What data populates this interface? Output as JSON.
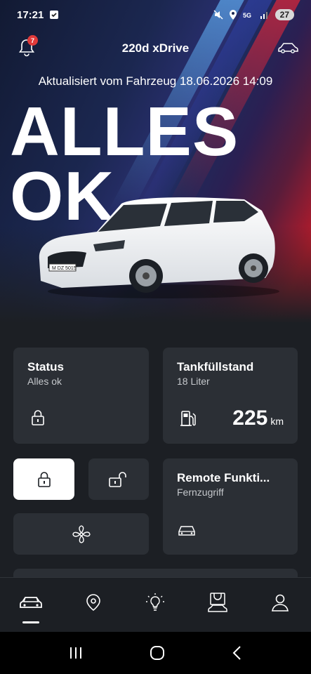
{
  "status_bar": {
    "time": "17:21",
    "battery": "27"
  },
  "header": {
    "title": "220d xDrive",
    "notification_count": "7"
  },
  "updated_text": "Aktualisiert vom Fahrzeug 18.06.2026 14:09",
  "hero": {
    "line1": "ALLES",
    "line2": "OK"
  },
  "car": {
    "plate": "M DZ 5015"
  },
  "status_card": {
    "title": "Status",
    "subtitle": "Alles ok"
  },
  "fuel_card": {
    "title": "Tankfüllstand",
    "subtitle": "18 Liter",
    "range_value": "225",
    "range_unit": "km"
  },
  "remote_card": {
    "title": "Remote Funkti...",
    "subtitle": "Fernzugriff"
  },
  "bottom_nav": [
    "vehicle",
    "map",
    "tips",
    "shop",
    "profile"
  ],
  "colors": {
    "background": "#1c1f24",
    "card": "#2b2f35",
    "accent_red": "#c4162a",
    "accent_blue": "#5aa2e6"
  }
}
